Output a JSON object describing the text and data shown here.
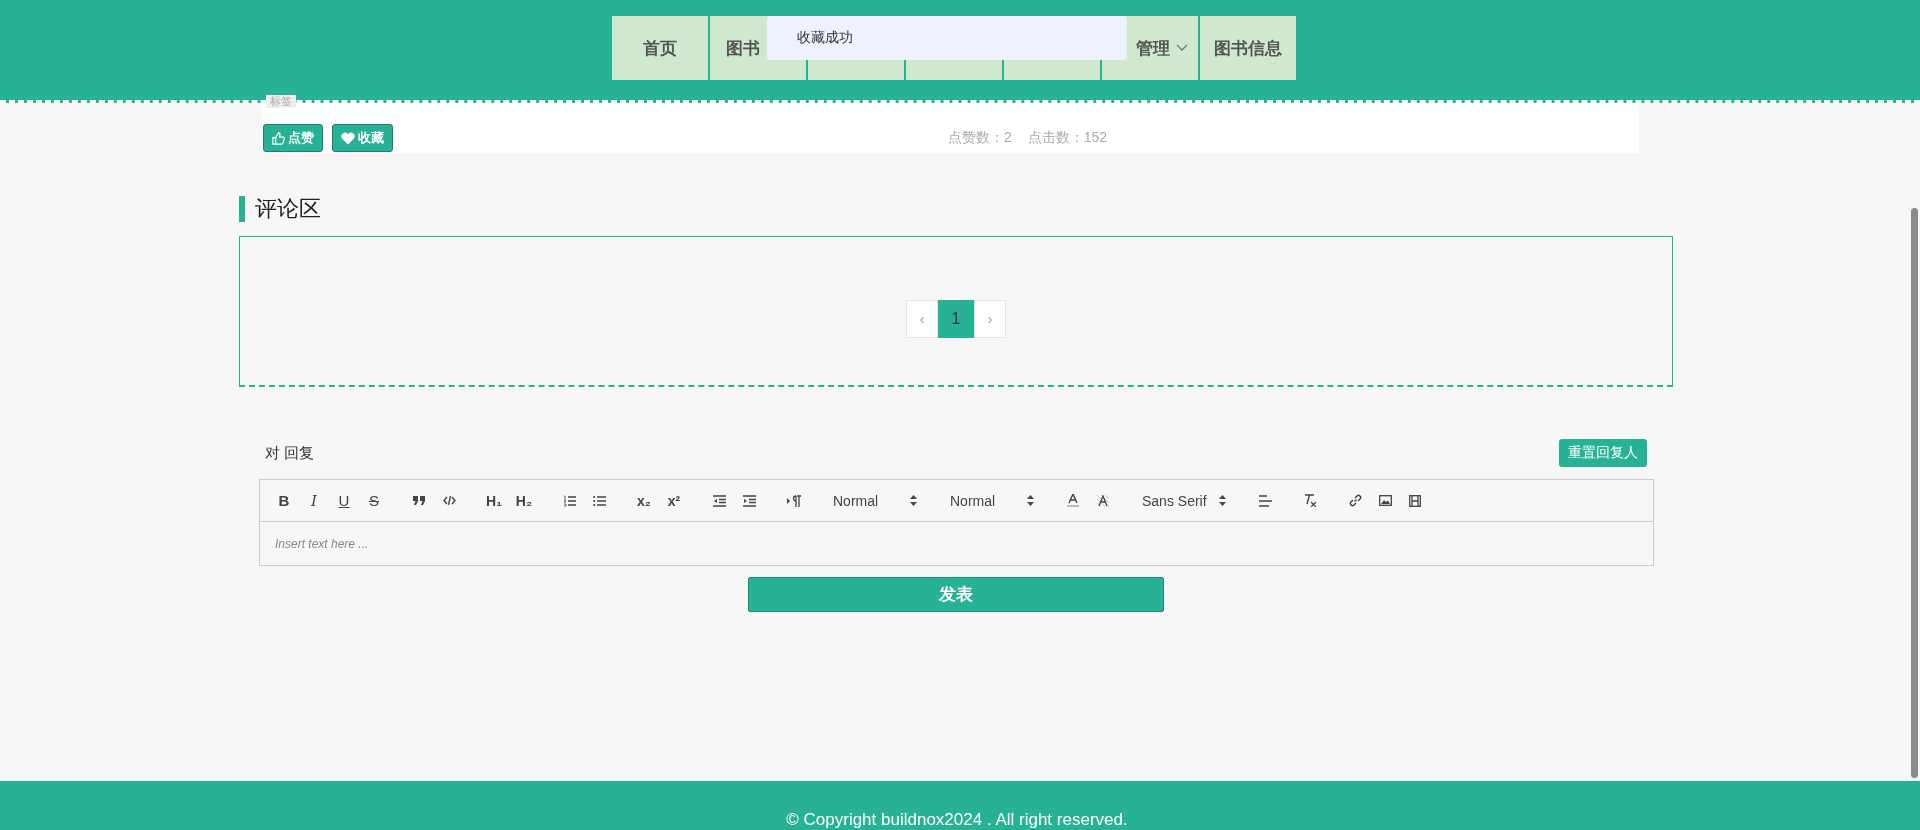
{
  "nav": [
    {
      "label": "首页",
      "dropdown": false
    },
    {
      "label": "图书",
      "dropdown": false
    },
    {
      "dropdown": false
    },
    {
      "dropdown": false
    },
    {
      "dropdown": false
    },
    {
      "label": "管理",
      "dropdown": true
    },
    {
      "label": "图书信息",
      "dropdown": false
    }
  ],
  "toast": {
    "message": "收藏成功"
  },
  "article": {
    "tag": "标签",
    "like_button": "点赞",
    "favorite_button": "收藏",
    "likes": "点赞数：2",
    "clicks": "点击数：152"
  },
  "comments": {
    "title": "评论区",
    "pagination": {
      "prev": "‹",
      "pages": [
        {
          "label": "1",
          "selected": true
        }
      ],
      "next": "›"
    }
  },
  "reply": {
    "label": "对 回复",
    "reset_button": "重置回复人",
    "toolbar": [
      [
        {
          "kind": "bold",
          "text": "B"
        },
        {
          "kind": "italic",
          "text": "I"
        },
        {
          "kind": "underline",
          "text": "U"
        },
        {
          "kind": "strike",
          "text": "S"
        }
      ],
      [
        {
          "kind": "icon"
        },
        {
          "kind": "icon"
        }
      ],
      [
        {
          "kind": "heading",
          "text": "H₁"
        },
        {
          "kind": "heading",
          "text": "H₂"
        }
      ],
      [
        {
          "kind": "icon"
        },
        {
          "kind": "icon"
        }
      ],
      [
        {
          "kind": "heading",
          "text": "x₂"
        },
        {
          "kind": "heading",
          "text": "x²"
        }
      ],
      [
        {
          "kind": "icon"
        },
        {
          "kind": "icon"
        }
      ],
      [
        {
          "kind": "icon"
        }
      ],
      [
        {
          "kind": "picker",
          "text": "Normal"
        }
      ],
      [
        {
          "kind": "picker",
          "text": "Normal"
        }
      ],
      [
        {
          "kind": "icon"
        },
        {
          "kind": "icon"
        }
      ],
      [
        {
          "kind": "picker",
          "text": "Sans Serif"
        }
      ],
      [
        {
          "kind": "icon"
        }
      ],
      [
        {
          "kind": "icon"
        }
      ],
      [
        {
          "kind": "icon"
        },
        {
          "kind": "icon"
        },
        {
          "kind": "icon"
        }
      ]
    ],
    "placeholder": "Insert text here ...",
    "submit_button": "发表"
  },
  "footer": {
    "copyright": "© Copyright buildnox2024 . All right reserved."
  }
}
